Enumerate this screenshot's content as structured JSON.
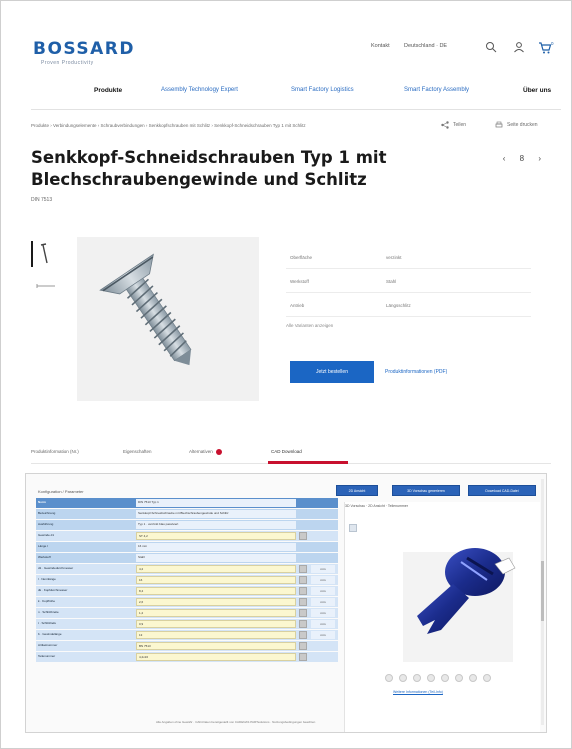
{
  "brand": {
    "logo_text": "BOSSARD",
    "tagline": "Proven Productivity",
    "accent": "#1f5fa8"
  },
  "header": {
    "util_links": [
      "Kontakt",
      "Deutschland · DE"
    ],
    "icons": [
      "search-icon",
      "user-icon",
      "cart-icon"
    ],
    "cart_count": "0"
  },
  "nav": {
    "items": [
      "Produkte",
      "Assembly Technology Expert",
      "Smart Factory Logistics",
      "Smart Factory Assembly",
      "Über uns"
    ]
  },
  "breadcrumb": {
    "text": "Produkte › Verbindungselemente › Schraubverbindungen › Senkkopfschrauben mit Schlitz › Senkkopf-Schneidschrauben Typ 1 mit Schlitz",
    "share_label": "Teilen",
    "print_label": "Seite drucken"
  },
  "product": {
    "title": "Senkkopf-Schneidschrauben Typ 1 mit Blechschraubengewinde und Schlitz",
    "standard": "DIN 7513",
    "pager": "‹ 8 ›",
    "thumb_labels": [
      "Produktbild",
      "Zeichnung"
    ],
    "info_rows": [
      {
        "key": "Oberfläche",
        "value": "verzinkt"
      },
      {
        "key": "Werkstoff",
        "value": "Stahl"
      },
      {
        "key": "Antrieb",
        "value": "Längsschlitz"
      }
    ],
    "info_note": "Alle Varianten anzeigen",
    "cta_label": "Jetzt bestellen",
    "link_label": "Produktinformationen (PDF)"
  },
  "tabs": {
    "items": [
      "Produktinformation (Nr.)",
      "Eigenschaften",
      "Alternativen",
      "CAD Download"
    ],
    "active_index": 3,
    "alert_color": "#c8102e"
  },
  "cad": {
    "section_label": "Konfiguration / Parameter",
    "buttons": [
      "2D Ansicht",
      "3D Vorschau generieren",
      "Download CAD-Datei"
    ],
    "viewer_tabs": "3D Vorschau   ·   2D Ansicht   ·   Teilenummer",
    "viewer_link": "Weitere Informationen (Teil-Info)",
    "footer_note": "Alle Angaben ohne Gewähr · CAD-Daten bereitgestellt von CADENAS PARTsolutions · Nutzungsbedingungen beachten",
    "rows": [
      {
        "key": "Norm",
        "value": "DIN 7513 Typ 1",
        "type": "head"
      },
      {
        "key": "Bezeichnung",
        "value": "Senkkopf-Schneidschraube mit Blechschraubengewinde und Schlitz",
        "type": "sub"
      },
      {
        "key": "Ausführung",
        "value": "Typ 1 · verzinkt blau passiviert",
        "type": "sub"
      },
      {
        "key": "Gewinde d1",
        "value": "ST 4,2",
        "type": "input"
      },
      {
        "key": "Länge l",
        "value": "16 mm",
        "type": "sub"
      },
      {
        "key": "Werkstoff",
        "value": "Stahl",
        "type": "sub"
      },
      {
        "key": "d1 · Gewindedurchmesser",
        "value": "4,2",
        "type": "input",
        "unit": "mm"
      },
      {
        "key": "l · Nennlänge",
        "value": "16",
        "type": "input",
        "unit": "mm"
      },
      {
        "key": "dk · Kopfdurchmesser",
        "value": "8,4",
        "type": "input",
        "unit": "mm"
      },
      {
        "key": "k · Kopfhöhe",
        "value": "2,6",
        "type": "input",
        "unit": "mm"
      },
      {
        "key": "n · Schlitzbreite",
        "value": "1,2",
        "type": "input",
        "unit": "mm"
      },
      {
        "key": "t · Schlitztiefe",
        "value": "0,9",
        "type": "input",
        "unit": "mm"
      },
      {
        "key": "b · Gewindelänge",
        "value": "13",
        "type": "input",
        "unit": "mm"
      },
      {
        "key": "Artikelnummer",
        "value": "BN 7513",
        "type": "input"
      },
      {
        "key": "Teilenummer",
        "value": "4,2x16",
        "type": "input"
      }
    ]
  }
}
